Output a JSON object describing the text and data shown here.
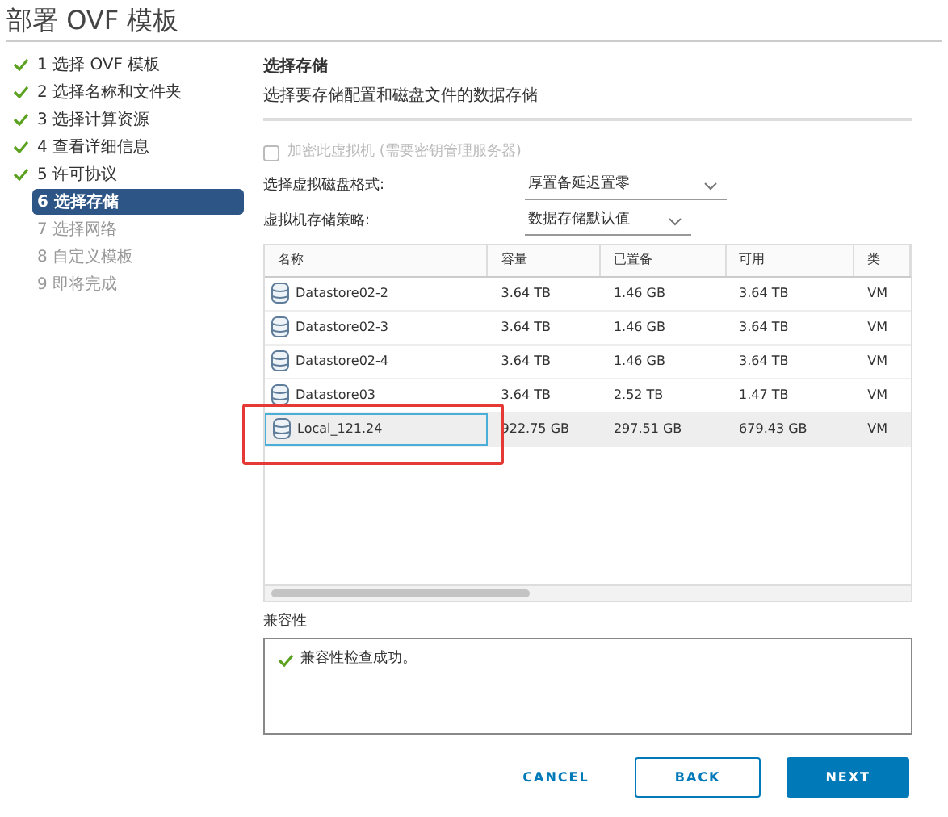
{
  "window": {
    "title": "部署 OVF 模板"
  },
  "steps": [
    {
      "label": "1 选择 OVF 模板",
      "completed": true,
      "selected": false
    },
    {
      "label": "2 选择名称和文件夹",
      "completed": true,
      "selected": false
    },
    {
      "label": "3 选择计算资源",
      "completed": true,
      "selected": false
    },
    {
      "label": "4 查看详细信息",
      "completed": true,
      "selected": false
    },
    {
      "label": "5 许可协议",
      "completed": true,
      "selected": false
    },
    {
      "label": "6 选择存储",
      "completed": false,
      "selected": true
    },
    {
      "label": "7 选择网络",
      "completed": false,
      "selected": false
    },
    {
      "label": "8 自定义模板",
      "completed": false,
      "selected": false
    },
    {
      "label": "9 即将完成",
      "completed": false,
      "selected": false
    }
  ],
  "page": {
    "title": "选择存储",
    "subtitle": "选择要存储配置和磁盘文件的数据存储"
  },
  "encrypt": {
    "label": "加密此虚拟机 (需要密钥管理服务器)",
    "checked": false,
    "disabled": true
  },
  "fields": [
    {
      "label": "选择虚拟磁盘格式:",
      "value": "厚置备延迟置零"
    },
    {
      "label": "虚拟机存储策略:",
      "value": "数据存储默认值"
    }
  ],
  "table": {
    "columns": [
      "名称",
      "容量",
      "已置备",
      "可用",
      "类"
    ],
    "rows": [
      {
        "cells": [
          "Datastore02-2",
          "3.64 TB",
          "1.46 GB",
          "3.64 TB",
          "VM"
        ],
        "selected": false
      },
      {
        "cells": [
          "Datastore02-3",
          "3.64 TB",
          "1.46 GB",
          "3.64 TB",
          "VM"
        ],
        "selected": false
      },
      {
        "cells": [
          "Datastore02-4",
          "3.64 TB",
          "1.46 GB",
          "3.64 TB",
          "VM"
        ],
        "selected": false
      },
      {
        "cells": [
          "Datastore03",
          "3.64 TB",
          "2.52 TB",
          "1.47 TB",
          "VM"
        ],
        "selected": false
      },
      {
        "cells": [
          "Local_121.24",
          "922.75 GB",
          "297.51 GB",
          "679.43 GB",
          "VM"
        ],
        "selected": true
      }
    ]
  },
  "compatibility": {
    "label": "兼容性",
    "message": "兼容性检查成功。"
  },
  "buttons": [
    {
      "label": "CANCEL",
      "kind": "flat"
    },
    {
      "label": "BACK",
      "kind": "outline"
    },
    {
      "label": "NEXT",
      "kind": "primary"
    }
  ]
}
